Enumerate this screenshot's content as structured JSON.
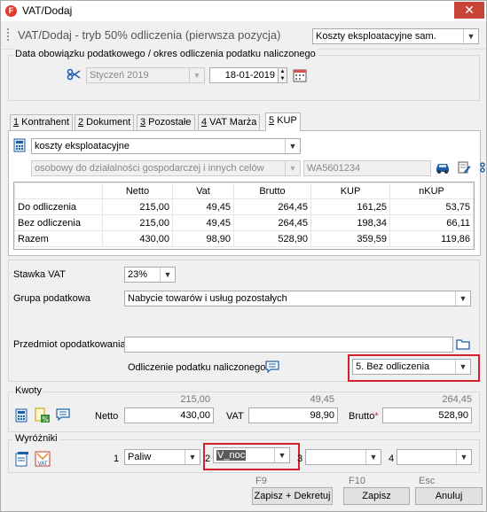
{
  "window": {
    "title": "VAT/Dodaj",
    "app_icon_letter": "F",
    "close_glyph": "✕"
  },
  "header": {
    "title": "VAT/Dodaj - tryb 50% odliczenia (pierwsza pozycja)",
    "cost_type": "Koszty eksploatacyjne sam."
  },
  "period_group": {
    "label": "Data obowiązku podatkowego / okres odliczenia podatku naliczonego",
    "month": "Styczeń 2019",
    "date": "18-01-2019"
  },
  "tabs": [
    {
      "num": "1",
      "label": " Kontrahent"
    },
    {
      "num": "2",
      "label": " Dokument"
    },
    {
      "num": "3",
      "label": " Pozostałe"
    },
    {
      "num": "4",
      "label": " VAT Marża"
    },
    {
      "num": "5",
      "label": " KUP"
    }
  ],
  "kup": {
    "category": "koszty eksploatacyjne",
    "vehicle_type": "osobowy do działalności gospodarczej i innych celów",
    "plate": "WA5601234",
    "table": {
      "headers": [
        "",
        "Netto",
        "Vat",
        "Brutto",
        "KUP",
        "nKUP"
      ],
      "rows": [
        [
          "Do odliczenia",
          "215,00",
          "49,45",
          "264,45",
          "161,25",
          "53,75"
        ],
        [
          "Bez odliczenia",
          "215,00",
          "49,45",
          "264,45",
          "198,34",
          "66,11"
        ],
        [
          "Razem",
          "430,00",
          "98,90",
          "528,90",
          "359,59",
          "119,86"
        ]
      ]
    }
  },
  "form": {
    "vat_rate_label": "Stawka VAT",
    "vat_rate": "23%",
    "tax_group_label": "Grupa podatkowa",
    "tax_group": "Nabycie towarów i usług pozostałych",
    "subject_label": "Przedmiot opodatkowania",
    "subject_value": "",
    "deduction_label": "Odliczenie podatku naliczonego",
    "deduction_value": "5. Bez odliczenia"
  },
  "amounts": {
    "label": "Kwoty",
    "netto_label": "Netto",
    "netto_hint": "215,00",
    "netto_value": "430,00",
    "vat_label": "VAT",
    "vat_hint": "49,45",
    "vat_value": "98,90",
    "brutto_label": "Brutto",
    "brutto_required": "*",
    "brutto_hint": "264,45",
    "brutto_value": "528,90"
  },
  "markers": {
    "label": "Wyróżniki",
    "m1_num": "1",
    "m1_value": "Paliw",
    "m2_num": "2",
    "m2_value": "V_noc",
    "m3_num": "3",
    "m3_value": "",
    "m4_num": "4",
    "m4_value": ""
  },
  "buttons": {
    "save_post_key": "F9",
    "save_post": "Zapisz + Dekretuj",
    "save_key": "F10",
    "save": "Zapisz",
    "cancel_key": "Esc",
    "cancel": "Anuluj"
  },
  "colors": {
    "highlight": "#d4212a",
    "accent_icon": "#1e5fa8",
    "close": "#c94436"
  }
}
